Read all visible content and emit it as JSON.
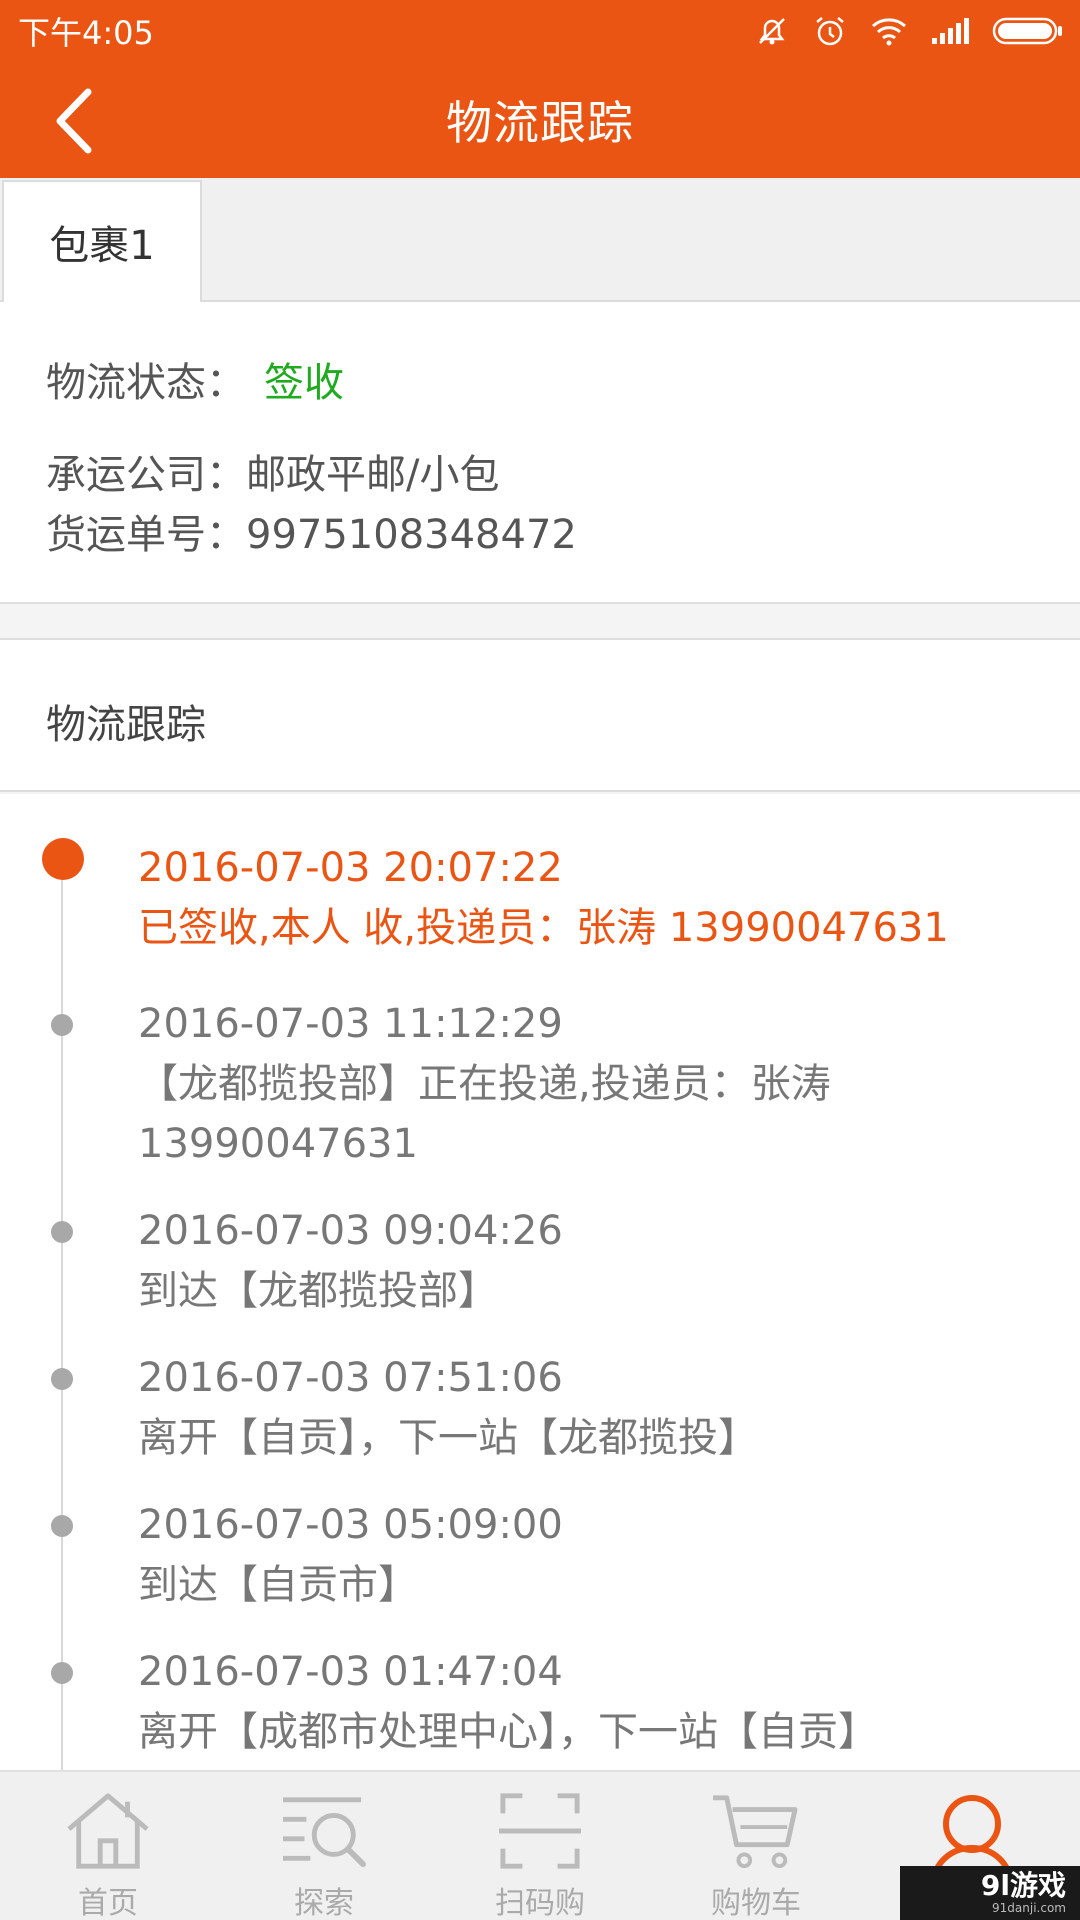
{
  "status_bar": {
    "time": "下午4:05"
  },
  "header": {
    "title": "物流跟踪"
  },
  "tabs": [
    {
      "label": "包裹1"
    }
  ],
  "package": {
    "status_label": "物流状态：",
    "status_value": "签收",
    "company_line": "承运公司：邮政平邮/小包",
    "number_line": "货运单号：9975108348472"
  },
  "tracking": {
    "title": "物流跟踪",
    "events": [
      {
        "time": "2016-07-03 20:07:22",
        "desc": "已签收,本人 收,投递员：张涛 13990047631"
      },
      {
        "time": "2016-07-03 11:12:29",
        "desc": "【龙都揽投部】正在投递,投递员：张涛",
        "desc2": "13990047631"
      },
      {
        "time": "2016-07-03 09:04:26",
        "desc": "到达【龙都揽投部】"
      },
      {
        "time": "2016-07-03 07:51:06",
        "desc": "离开【自贡】，下一站【龙都揽投】"
      },
      {
        "time": "2016-07-03 05:09:00",
        "desc": "到达【自贡市】"
      },
      {
        "time": "2016-07-03 01:47:04",
        "desc": "离开【成都市处理中心】，下一站【自贡】"
      }
    ]
  },
  "bottom_nav": [
    {
      "label": "首页",
      "icon": "home-icon"
    },
    {
      "label": "探索",
      "icon": "explore-icon"
    },
    {
      "label": "扫码购",
      "icon": "scan-icon"
    },
    {
      "label": "购物车",
      "icon": "cart-icon"
    },
    {
      "label": "",
      "icon": "user-icon"
    }
  ],
  "watermark": {
    "main": "9l游戏",
    "sub": "91danji.com"
  },
  "colors": {
    "accent": "#ea5514",
    "success": "#1faa1f",
    "muted": "#777777"
  }
}
